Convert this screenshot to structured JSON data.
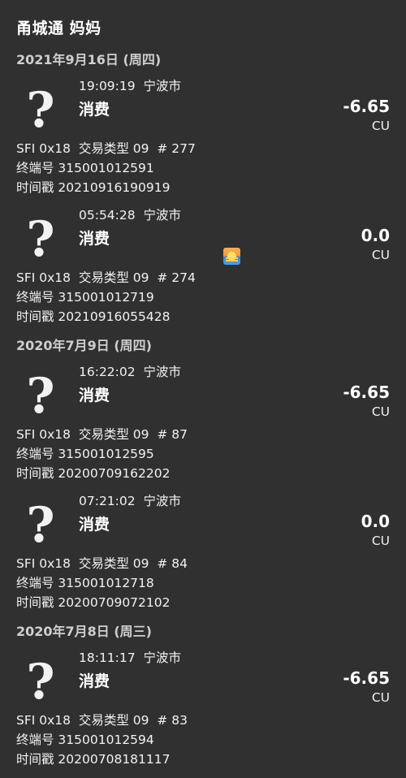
{
  "header": {
    "title": "甬城通 妈妈"
  },
  "groups": [
    {
      "date": "2021年9月16日 (周四)",
      "transactions": [
        {
          "time_loc": "19:09:19  宁波市",
          "type": "消费",
          "amount": "-6.65",
          "unit": "CU",
          "sfi": "SFI 0x18  交易类型 09  # 277",
          "terminal": "终端号 315001012591",
          "timestamp": "时间戳 20210916190919"
        },
        {
          "time_loc": "05:54:28  宁波市",
          "type": "消费",
          "amount": "0.0",
          "unit": "CU",
          "sfi": "SFI 0x18  交易类型 09  # 274",
          "terminal": "终端号 315001012719",
          "timestamp": "时间戳 20210916055428"
        }
      ]
    },
    {
      "date": "2020年7月9日 (周四)",
      "transactions": [
        {
          "time_loc": "16:22:02  宁波市",
          "type": "消费",
          "amount": "-6.65",
          "unit": "CU",
          "sfi": "SFI 0x18  交易类型 09  # 87",
          "terminal": "终端号 315001012595",
          "timestamp": "时间戳 20200709162202"
        },
        {
          "time_loc": "07:21:02  宁波市",
          "type": "消费",
          "amount": "0.0",
          "unit": "CU",
          "sfi": "SFI 0x18  交易类型 09  # 84",
          "terminal": "终端号 315001012718",
          "timestamp": "时间戳 20200709072102"
        }
      ]
    },
    {
      "date": "2020年7月8日 (周三)",
      "transactions": [
        {
          "time_loc": "18:11:17  宁波市",
          "type": "消费",
          "amount": "-6.65",
          "unit": "CU",
          "sfi": "SFI 0x18  交易类型 09  # 83",
          "terminal": "终端号 315001012594",
          "timestamp": "时间戳 20200708181117"
        }
      ]
    }
  ],
  "icons": {
    "transaction_icon": "question-mark-icon",
    "sunrise_emoji": "sunrise-icon"
  },
  "colors": {
    "background": "#303030",
    "text": "#ffffff",
    "date_header": "#cfcfcf"
  }
}
